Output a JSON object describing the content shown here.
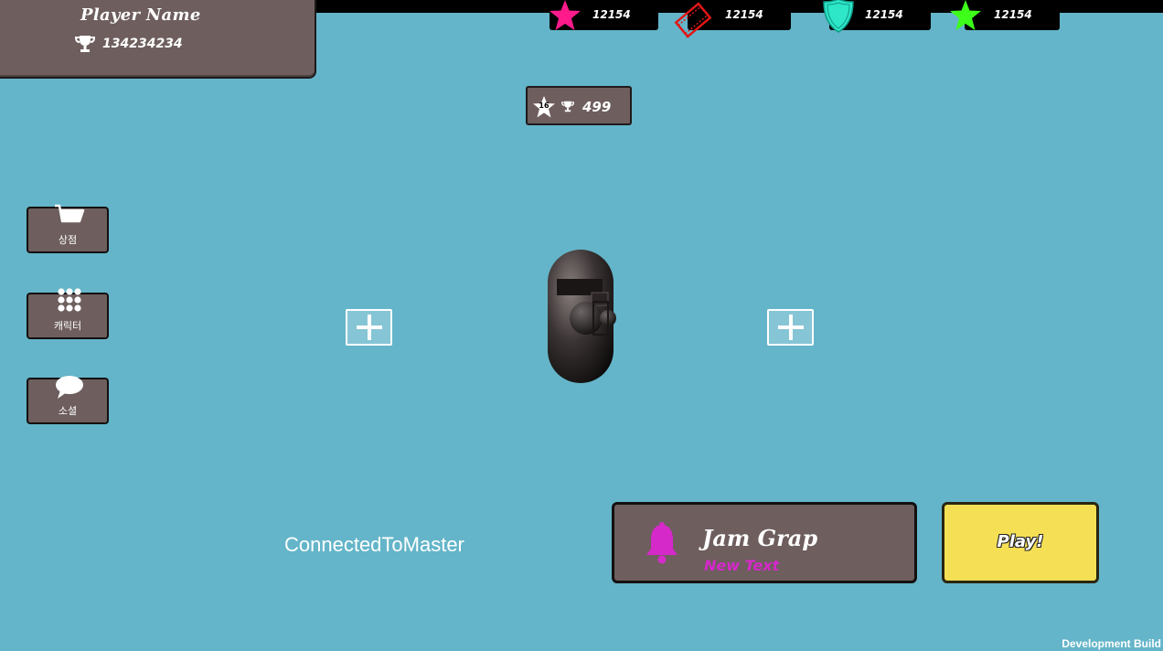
{
  "player": {
    "name": "Player Name",
    "trophies": "134234234",
    "trophy_icon": "trophy-icon"
  },
  "resources": [
    {
      "icon": "pink-star-icon",
      "value": "12154",
      "color": "#ff1a8c"
    },
    {
      "icon": "red-film-ticket-icon",
      "value": "12154",
      "color": "#ff0000"
    },
    {
      "icon": "cyan-shield-icon",
      "value": "12154",
      "color": "#2ee6c8"
    },
    {
      "icon": "green-star-icon",
      "value": "12154",
      "color": "#3dff1a"
    }
  ],
  "trophy_badge": {
    "level": "16",
    "trophies": "499"
  },
  "side_menu": [
    {
      "label": "상점",
      "icon": "shopping-cart-icon"
    },
    {
      "label": "캐릭터",
      "icon": "grid-dots-icon"
    },
    {
      "label": "소셜",
      "icon": "chat-bubble-icon"
    }
  ],
  "status": "ConnectedToMaster",
  "game_mode": {
    "title": "Jam Grap",
    "subtitle": "New Text",
    "icon": "bell-icon",
    "accent": "#d529c9"
  },
  "play_button": {
    "label": "Play!",
    "color": "#f5df55"
  },
  "footer": {
    "build_label": "Development Build"
  }
}
